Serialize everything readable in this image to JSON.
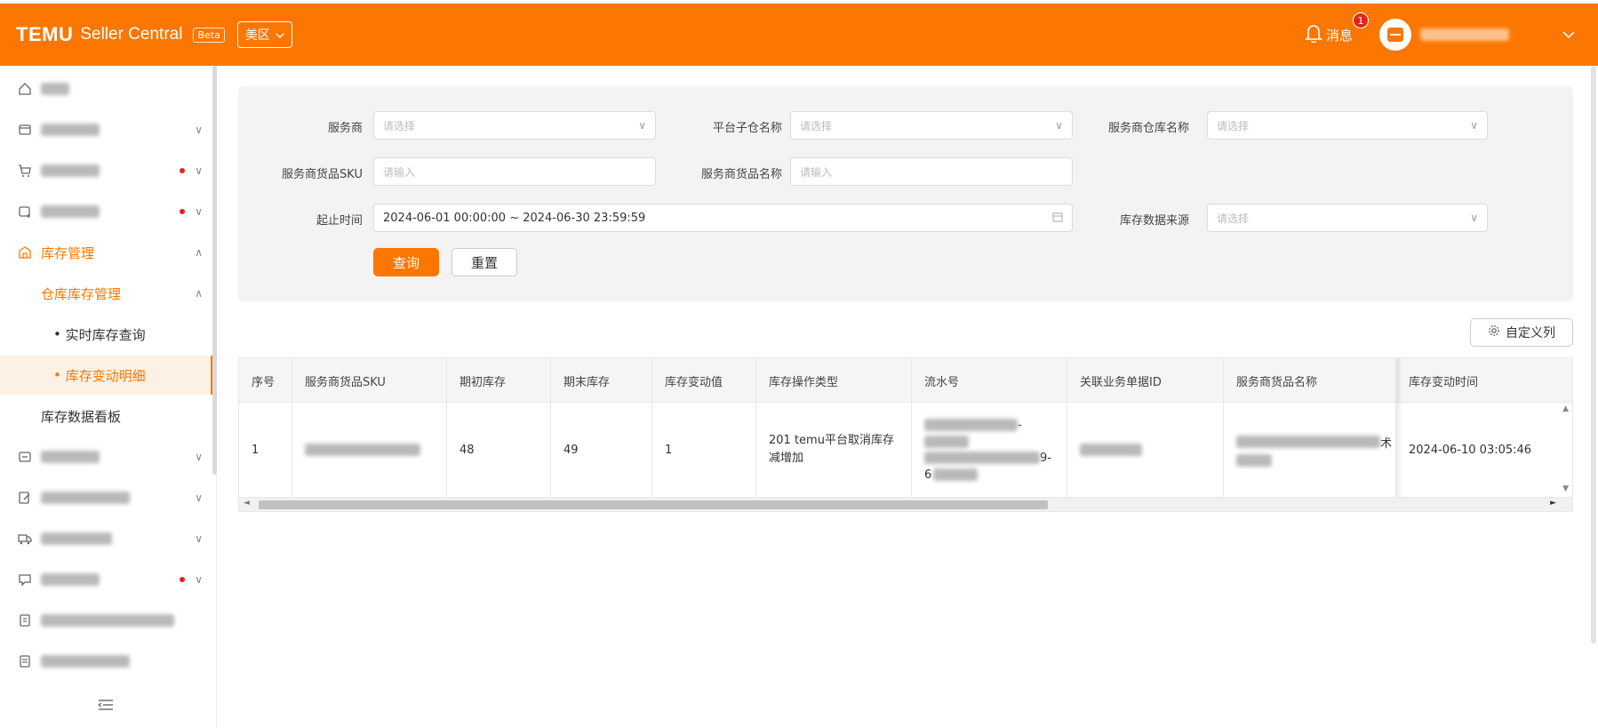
{
  "header": {
    "logo": "TEMU",
    "product": "Seller Central",
    "beta": "Beta",
    "region": "美区",
    "messages_label": "消息",
    "messages_count": "1",
    "accent_color": "#fb7701"
  },
  "sidebar": {
    "inventory_label": "库存管理",
    "warehouse_inventory_label": "仓库库存管理",
    "realtime_query_label": "实时库存查询",
    "change_detail_label": "库存变动明细",
    "dashboard_label": "库存数据看板"
  },
  "filters": {
    "service_provider_label": "服务商",
    "service_provider_placeholder": "请选择",
    "platform_sub_warehouse_label": "平台子仓名称",
    "platform_sub_warehouse_placeholder": "请选择",
    "provider_warehouse_label": "服务商仓库名称",
    "provider_warehouse_placeholder": "请选择",
    "provider_sku_label": "服务商货品SKU",
    "provider_sku_placeholder": "请输入",
    "provider_goods_name_label": "服务商货品名称",
    "provider_goods_name_placeholder": "请输入",
    "time_range_label": "起止时间",
    "time_range_value": "2024-06-01 00:00:00 ~ 2024-06-30 23:59:59",
    "data_source_label": "库存数据来源",
    "data_source_placeholder": "请选择",
    "query_button": "查询",
    "reset_button": "重置"
  },
  "custom_columns_button": "自定义列",
  "table": {
    "columns": [
      "序号",
      "服务商货品SKU",
      "期初库存",
      "期末库存",
      "库存变动值",
      "库存操作类型",
      "流水号",
      "关联业务单据ID",
      "服务商货品名称",
      "库存变动时间"
    ],
    "rows": [
      {
        "index": "1",
        "opening_stock": "48",
        "closing_stock": "49",
        "change_value": "1",
        "operation_type": "201 temu平台取消库存减增加",
        "serial_fragment_1": "-",
        "serial_fragment_2": "9-",
        "serial_fragment_3": "6",
        "goods_name_fragment": "术",
        "change_time": "2024-06-10 03:05:46"
      }
    ]
  }
}
